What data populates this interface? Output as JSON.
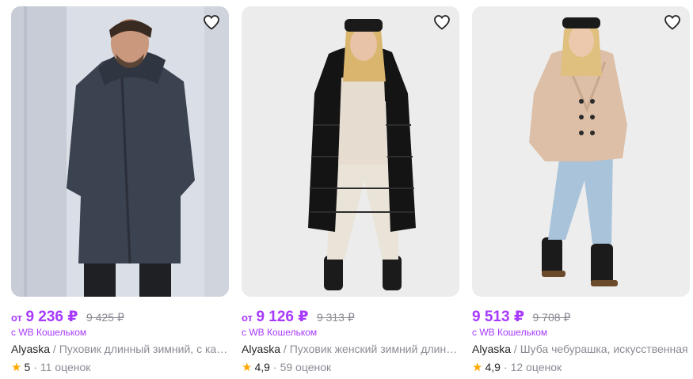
{
  "currency": "₽",
  "accent_color": "#a73afd",
  "star_color": "#ffa800",
  "products": [
    {
      "price_prefix": "от",
      "price": "9 236 ₽",
      "old_price": "9 425 ₽",
      "wallet_label": "с WB Кошельком",
      "brand": "Alyaska",
      "separator": " / ",
      "name": "Пуховик длинный зимний, с капюшоном",
      "rating": "5",
      "reviews": "11 оценок",
      "favorite_icon": "heart-icon"
    },
    {
      "price_prefix": "от",
      "price": "9 126 ₽",
      "old_price": "9 313 ₽",
      "wallet_label": "с WB Кошельком",
      "brand": "Alyaska",
      "separator": " / ",
      "name": "Пуховик женский зимний длинный",
      "rating": "4,9",
      "reviews": "59 оценок",
      "favorite_icon": "heart-icon"
    },
    {
      "price_prefix": "",
      "price": "9 513 ₽",
      "old_price": "9 708 ₽",
      "wallet_label": "с WB Кошельком",
      "brand": "Alyaska",
      "separator": " / ",
      "name": "Шуба чебурашка, искусственная",
      "rating": "4,9",
      "reviews": "12 оценок",
      "favorite_icon": "heart-icon"
    }
  ]
}
